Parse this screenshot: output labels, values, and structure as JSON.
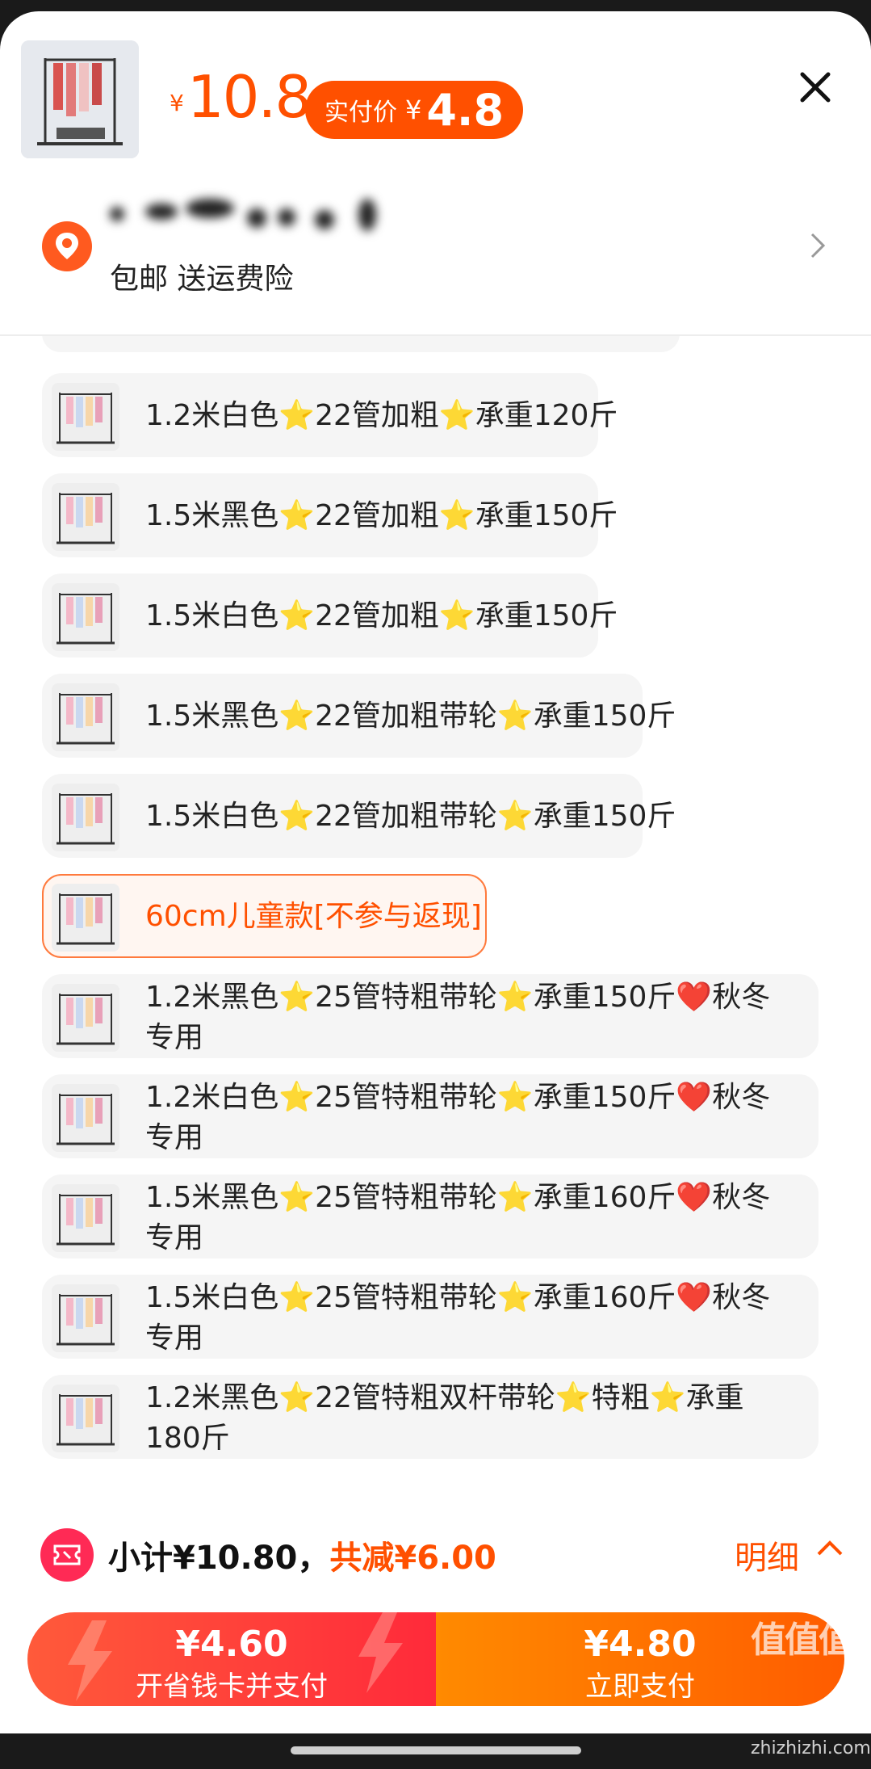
{
  "header": {
    "yen_symbol": "¥",
    "price": "10.8",
    "real_price_label": "实付价",
    "real_price_yen": "¥",
    "real_price_value": "4.8"
  },
  "shipping": {
    "text": "包邮 送运费险"
  },
  "options": [
    {
      "label": "1.2米白色⭐22管加粗⭐承重120斤",
      "selected": false,
      "lines": 1
    },
    {
      "label": "1.5米黑色⭐22管加粗⭐承重150斤",
      "selected": false,
      "lines": 1
    },
    {
      "label": "1.5米白色⭐22管加粗⭐承重150斤",
      "selected": false,
      "lines": 1
    },
    {
      "label": "1.5米黑色⭐22管加粗带轮⭐承重150斤",
      "selected": false,
      "lines": 1
    },
    {
      "label": "1.5米白色⭐22管加粗带轮⭐承重150斤",
      "selected": false,
      "lines": 1
    },
    {
      "label": "60cm儿童款[不参与返现]",
      "selected": true,
      "lines": 1
    },
    {
      "label": "1.2米黑色⭐25管特粗带轮⭐承重150斤❤️秋冬专用",
      "selected": false,
      "lines": 2
    },
    {
      "label": "1.2米白色⭐25管特粗带轮⭐承重150斤❤️秋冬专用",
      "selected": false,
      "lines": 2
    },
    {
      "label": "1.5米黑色⭐25管特粗带轮⭐承重160斤❤️秋冬专用",
      "selected": false,
      "lines": 2
    },
    {
      "label": "1.5米白色⭐25管特粗带轮⭐承重160斤❤️秋冬专用",
      "selected": false,
      "lines": 2
    },
    {
      "label": "1.2米黑色⭐22管特粗双杆带轮⭐特粗⭐承重180斤",
      "selected": false,
      "lines": 2
    }
  ],
  "summary": {
    "subtotal": "小计¥10.80，",
    "discount": "共减¥6.00",
    "detail_label": "明细"
  },
  "pay": {
    "left_amount": "¥4.60",
    "left_label": "开省钱卡并支付",
    "right_amount": "¥4.80",
    "right_label": "立即支付"
  },
  "watermark": {
    "logo": "值值值",
    "site": "zhizhizhi.com"
  },
  "colors": {
    "accent": "#ff5000",
    "option_bg": "#f5f5f5",
    "selected_border": "#ff7a3d"
  }
}
